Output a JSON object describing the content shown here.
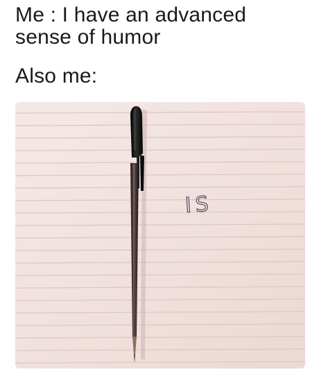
{
  "caption": {
    "line1": "Me : I have an advanced",
    "line2": "sense of humor",
    "line3": "Also me:"
  },
  "photo": {
    "handwritten_text": "IS",
    "paper_color": "#f2e4e1",
    "rule_color": "#d9c2c0",
    "pen_cap_color": "#111111",
    "pen_barrel_color": "#3a2a2a"
  }
}
